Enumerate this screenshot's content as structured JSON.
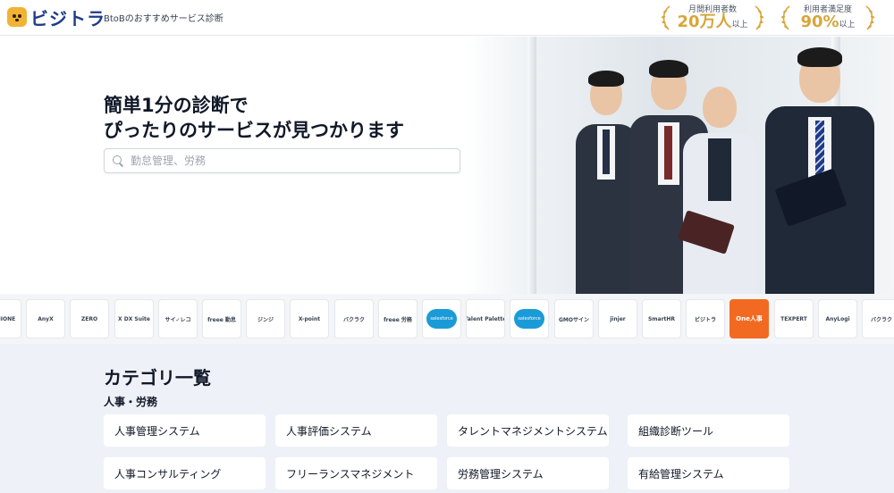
{
  "header": {
    "logo_text": "ビジトラ",
    "tagline": "BtoBのおすすめサービス診断",
    "stats": [
      {
        "label": "月間利用者数",
        "value": "20万人",
        "suffix": "以上"
      },
      {
        "label": "利用者満足度",
        "value": "90%",
        "suffix": "以上"
      }
    ]
  },
  "hero": {
    "title_line1": "簡単1分の診断で",
    "title_line2": "ぴったりのサービスが見つかります",
    "search_placeholder": "勤怠管理、労務",
    "search_value": ""
  },
  "logo_strip": [
    {
      "name": "GENIONE",
      "kind": "text"
    },
    {
      "name": "AnyX",
      "kind": "text"
    },
    {
      "name": "ZERO",
      "kind": "text"
    },
    {
      "name": "X DX Suite",
      "kind": "text"
    },
    {
      "name": "サイ✓レコ",
      "kind": "text"
    },
    {
      "name": "freee 勤怠",
      "kind": "text"
    },
    {
      "name": "ジンジ",
      "kind": "text"
    },
    {
      "name": "X-point",
      "kind": "text"
    },
    {
      "name": "バクラク",
      "kind": "text"
    },
    {
      "name": "freee 労務",
      "kind": "text"
    },
    {
      "name": "salesforce",
      "kind": "salesforce"
    },
    {
      "name": "Talent Palette",
      "kind": "text"
    },
    {
      "name": "salesforce",
      "kind": "salesforce"
    },
    {
      "name": "GMOサイン",
      "kind": "text"
    },
    {
      "name": "jinjer",
      "kind": "text"
    },
    {
      "name": "SmartHR",
      "kind": "text"
    },
    {
      "name": "ビジトラ",
      "kind": "text"
    },
    {
      "name": "One人事",
      "kind": "orange"
    },
    {
      "name": "TEXPERT",
      "kind": "text"
    },
    {
      "name": "AnyLogi",
      "kind": "text"
    },
    {
      "name": "バクラク",
      "kind": "text"
    }
  ],
  "category": {
    "title": "カテゴリ一覧",
    "subtitle": "人事・労務",
    "items": [
      "人事管理システム",
      "人事評価システム",
      "タレントマネジメントシステム",
      "組織診断ツール",
      "人事コンサルティング",
      "フリーランスマネジメント",
      "労務管理システム",
      "有給管理システム"
    ]
  },
  "colors": {
    "brand_navy": "#1e3a8a",
    "gold": "#d7a63a",
    "category_bg": "#eef1f8"
  }
}
